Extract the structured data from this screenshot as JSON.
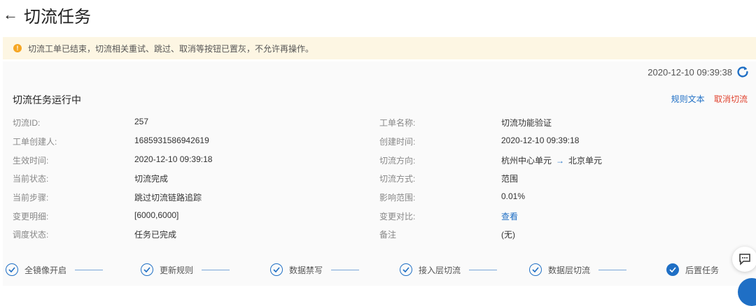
{
  "header": {
    "back_icon": "arrow-left-icon",
    "title": "切流任务"
  },
  "alert": {
    "icon": "warning-icon",
    "color": "#f5a623",
    "text": "切流工单已结束，切流相关重试、跳过、取消等按钮已置灰，不允许再操作。"
  },
  "card": {
    "timestamp": "2020-12-10 09:39:38",
    "refresh_icon": "refresh-icon",
    "title": "切流任务运行中",
    "actions": {
      "rule_text": "规则文本",
      "cancel": "取消切流"
    },
    "left_fields": [
      {
        "label": "切流ID:",
        "value": "257"
      },
      {
        "label": "工单创建人:",
        "value": "1685931586942619"
      },
      {
        "label": "生效时间:",
        "value": "2020-12-10 09:39:18"
      },
      {
        "label": "当前状态:",
        "value": "切流完成"
      },
      {
        "label": "当前步骤:",
        "value": "跳过切流链路追踪"
      },
      {
        "label": "变更明细:",
        "value": "[6000,6000]"
      },
      {
        "label": "调度状态:",
        "value": "任务已完成"
      }
    ],
    "right_fields": [
      {
        "label": "工单名称:",
        "value": "切流功能验证"
      },
      {
        "label": "创建时间:",
        "value": "2020-12-10 09:39:18"
      },
      {
        "label": "切流方向:",
        "value_from": "杭州中心单元",
        "value_to": "北京单元"
      },
      {
        "label": "切流方式:",
        "value": "范围"
      },
      {
        "label": "影响范围:",
        "value": "0.01%"
      },
      {
        "label": "变更对比:",
        "value": "查看"
      },
      {
        "label": "备注",
        "value": "(无)"
      }
    ]
  },
  "steps": [
    {
      "label": "全镜像开启",
      "state": "done"
    },
    {
      "label": "更新规则",
      "state": "done"
    },
    {
      "label": "数据禁写",
      "state": "done"
    },
    {
      "label": "接入层切流",
      "state": "done"
    },
    {
      "label": "数据层切流",
      "state": "done"
    },
    {
      "label": "后置任务",
      "state": "current"
    }
  ],
  "colors": {
    "accent": "#1f6fc5",
    "danger": "#e0432f",
    "alert_bg": "#fdf6e3"
  }
}
